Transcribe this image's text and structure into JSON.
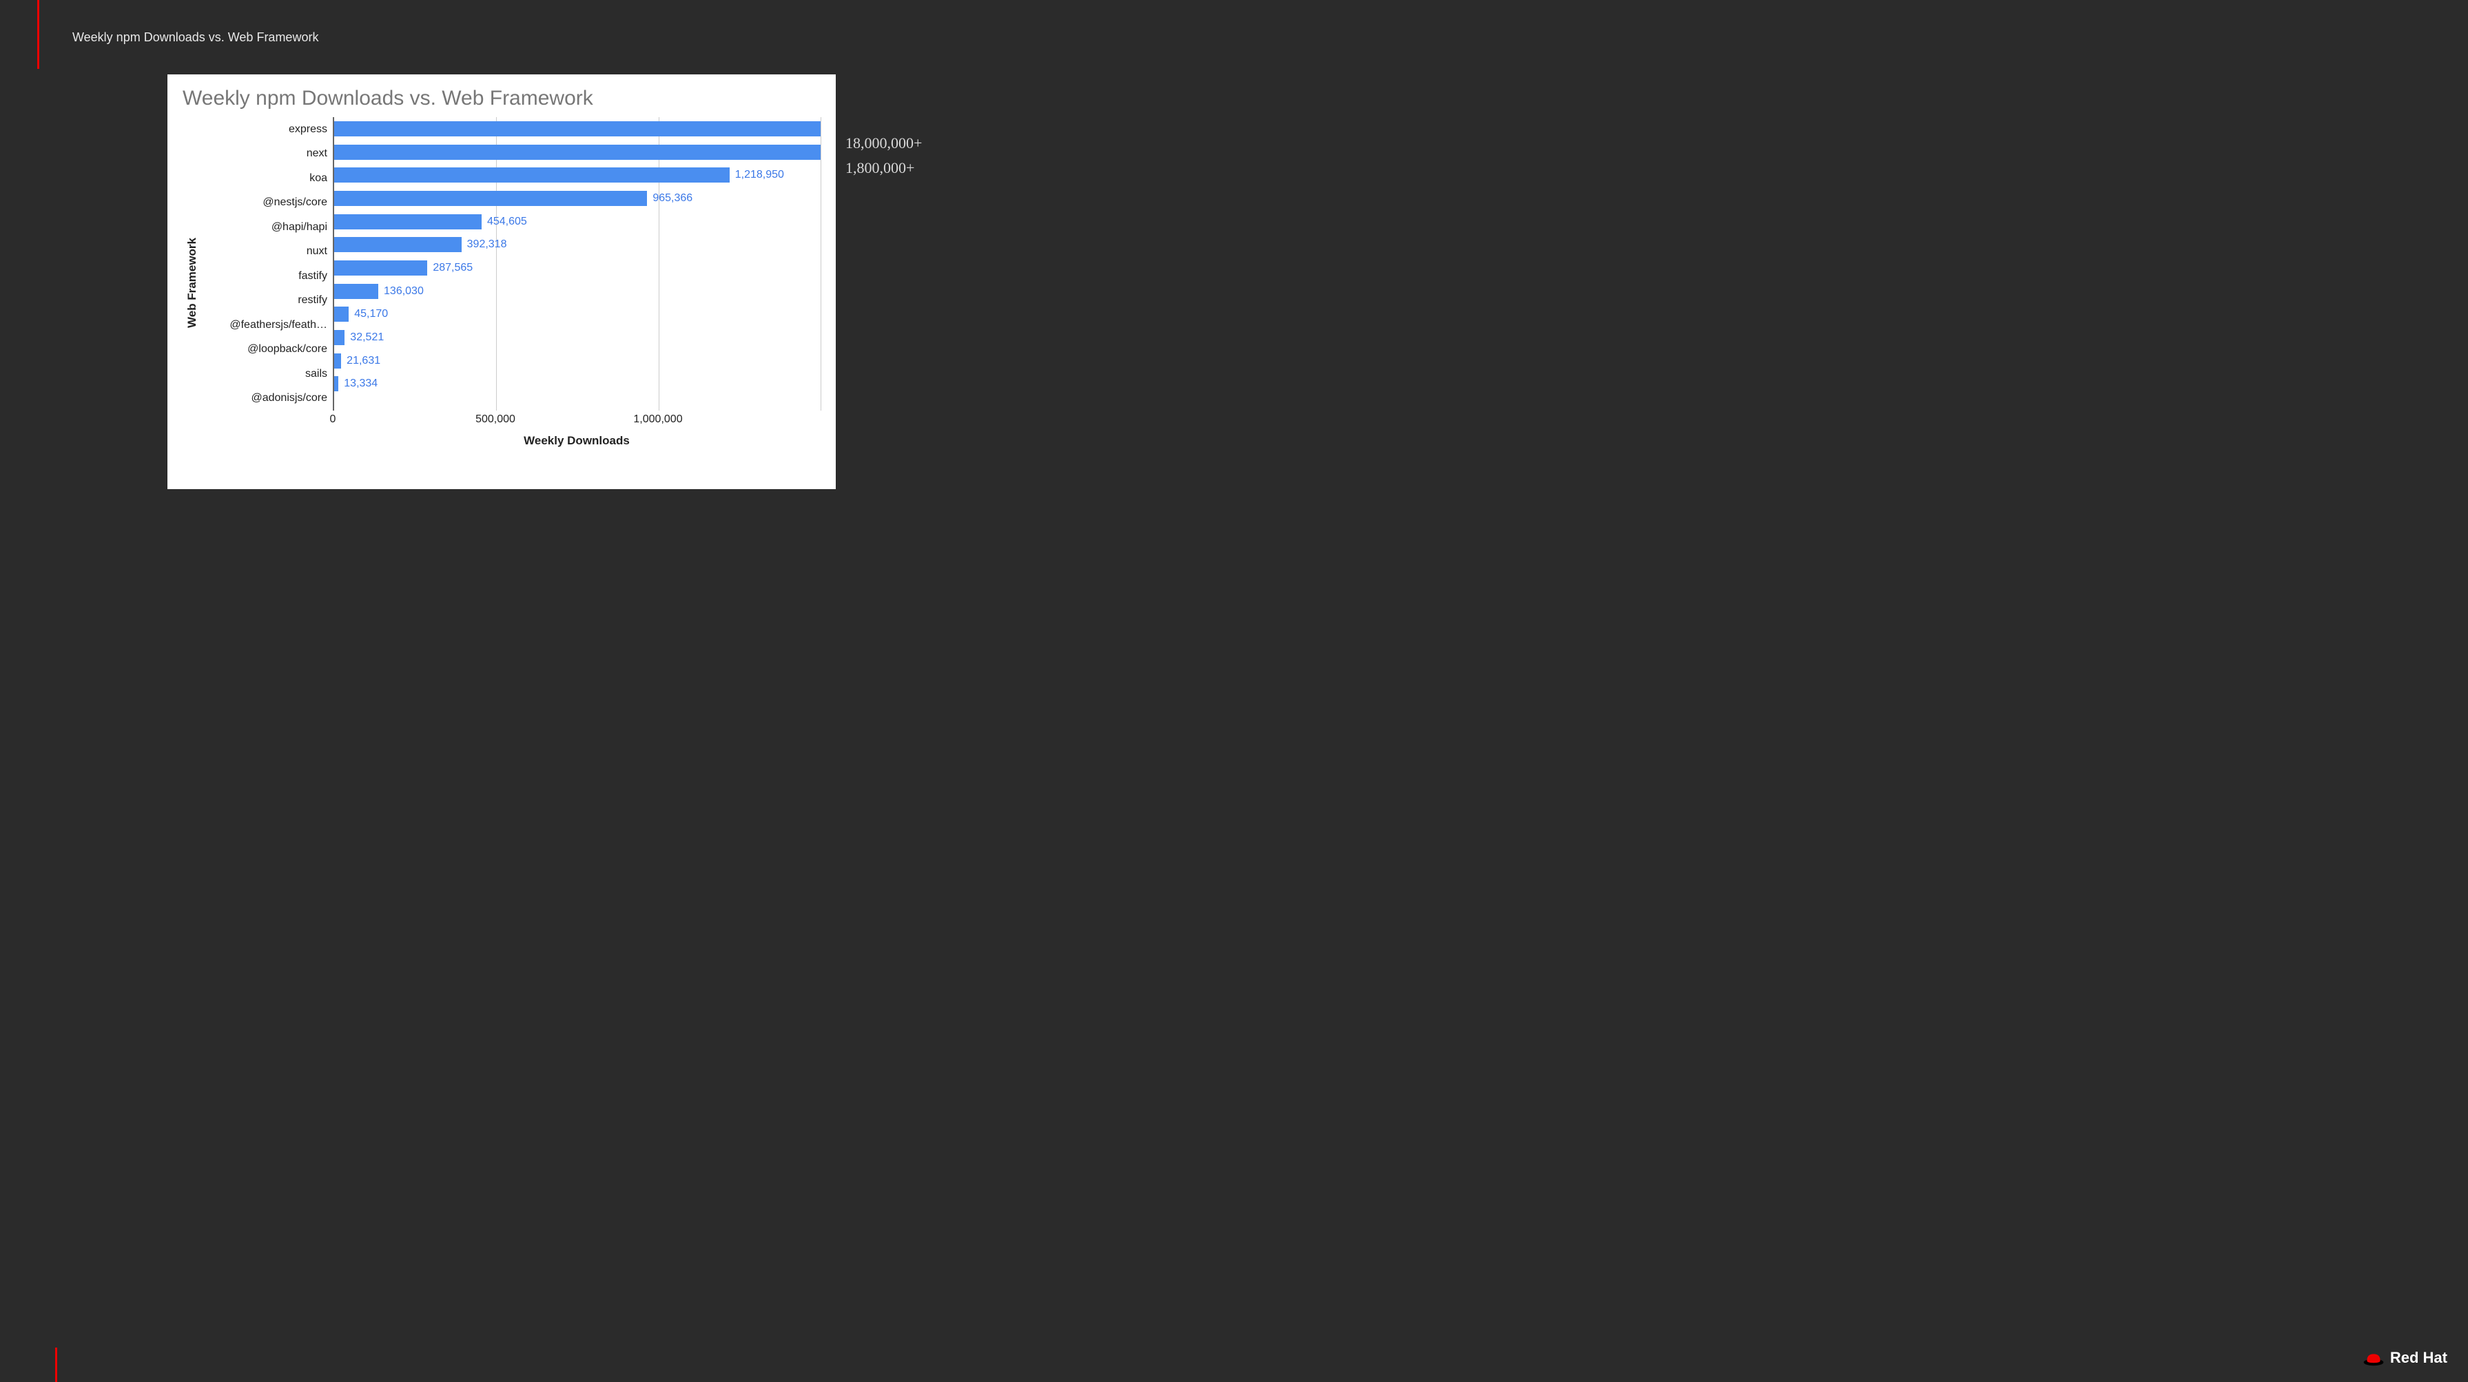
{
  "slide_title": "Weekly npm Downloads vs. Web Framework",
  "chart_data": {
    "type": "bar",
    "orientation": "horizontal",
    "title": "Weekly npm Downloads vs. Web Framework",
    "xlabel": "Weekly Downloads",
    "ylabel": "Web Framework",
    "xlim": [
      0,
      1500000
    ],
    "xticks": [
      {
        "value": 0,
        "label": "0"
      },
      {
        "value": 500000,
        "label": "500,000"
      },
      {
        "value": 1000000,
        "label": "1,000,000"
      }
    ],
    "categories": [
      "express",
      "next",
      "koa",
      "@nestjs/core",
      "@hapi/hapi",
      "nuxt",
      "fastify",
      "restify",
      "@feathersjs/feath…",
      "@loopback/core",
      "sails",
      "@adonisjs/core"
    ],
    "values": [
      18000000,
      1800000,
      1218950,
      965366,
      454605,
      392318,
      287565,
      136030,
      45170,
      32521,
      21631,
      13334
    ],
    "display_values": [
      null,
      null,
      "1,218,950",
      "965,366",
      "454,605",
      "392,318",
      "287,565",
      "136,030",
      "45,170",
      "32,521",
      "21,631",
      "13,334"
    ],
    "gridlines": [
      500000,
      1000000,
      1500000
    ]
  },
  "annotations": [
    "18,000,000+",
    "1,800,000+"
  ],
  "logo": {
    "text": "Red Hat",
    "color": "#ee0000"
  }
}
